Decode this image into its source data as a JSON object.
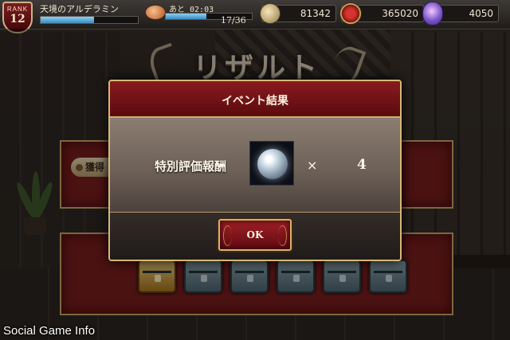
{
  "hud": {
    "rank_label": "RANK",
    "rank": "12",
    "player_name": "天境のアルデラミン",
    "exp_fraction": 0.55,
    "stamina_timer": "あと 02:03",
    "stamina_count": "17/36",
    "stamina_fraction": 0.47,
    "coins": "81342",
    "medals": "365020",
    "gems": "4050"
  },
  "background": {
    "title": "リザルト",
    "acquire_label": "獲得"
  },
  "dialog": {
    "title": "イベント結果",
    "reward_name": "特別評価報酬",
    "multiply_sign": "×",
    "quantity": "4",
    "ok_label": "OK"
  },
  "chests": [
    {
      "type": "gold"
    },
    {
      "type": "silver"
    },
    {
      "type": "silver"
    },
    {
      "type": "silver"
    },
    {
      "type": "silver"
    },
    {
      "type": "silver"
    }
  ],
  "watermark": "Social Game Info",
  "colors": {
    "accent_red": "#8a1a1e",
    "gold_border": "#d7b776",
    "bar_blue": "#3a8cbf"
  }
}
